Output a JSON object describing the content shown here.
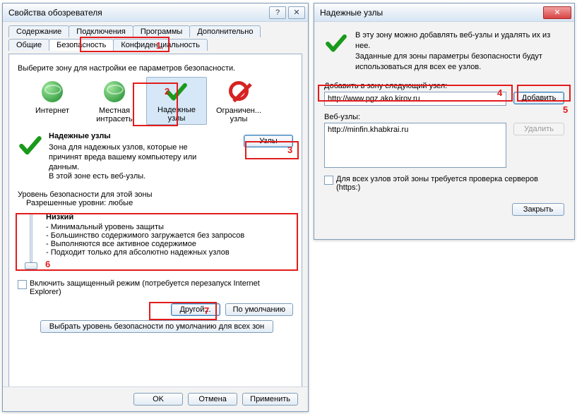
{
  "left": {
    "title": "Свойства обозревателя",
    "tabs_row1": [
      "Содержание",
      "Подключения",
      "Программы",
      "Дополнительно"
    ],
    "tabs_row2": [
      "Общие",
      "Безопасность",
      "Конфиденциальность"
    ],
    "active_tab": "Безопасность",
    "instruction": "Выберите зону для настройки ее параметров безопасности.",
    "zones": [
      {
        "label": "Интернет"
      },
      {
        "label2": "Местная",
        "label3": "интрасеть"
      },
      {
        "label2": "Надежные",
        "label3": "узлы"
      },
      {
        "label2": "Ограничен...",
        "label3": "узлы"
      }
    ],
    "zone_header_title": "Надежные узлы",
    "zone_header_desc_1": "Зона для надежных узлов, которые не",
    "zone_header_desc_2": "причинят вреда вашему компьютеру или",
    "zone_header_desc_3": "данным.",
    "zone_header_desc_4": "В этой зоне есть веб-узлы.",
    "nodes_btn": "Узлы",
    "sec_level_label": "Уровень безопасности для этой зоны",
    "allowed_levels": "Разрешенные уровни: любые",
    "level_name": "Низкий",
    "level_bullets": [
      "Минимальный уровень защиты",
      "Большинство содержимого загружается без запросов",
      "Выполняются все активное содержимое",
      "Подходит только для абсолютно надежных узлов"
    ],
    "protected_mode": "Включить защищенный режим (потребуется перезапуск Internet Explorer)",
    "btn_other": "Другой...",
    "btn_default": "По умолчанию",
    "btn_reset_all": "Выбрать уровень безопасности по умолчанию для всех зон",
    "btn_ok": "OK",
    "btn_cancel": "Отмена",
    "btn_apply": "Применить"
  },
  "right": {
    "title": "Надежные узлы",
    "desc_1": "В эту зону можно добавлять веб-узлы и удалять их из нее.",
    "desc_2": "Заданные для зоны параметры безопасности будут",
    "desc_3": "использоваться для всех ее узлов.",
    "add_label": "Добавить в зону следующий узел:",
    "add_value": "http://www.pgz.ako.kirov.ru",
    "btn_add": "Добавить",
    "sites_label": "Веб-узлы:",
    "sites": [
      "http://minfin.khabkrai.ru"
    ],
    "btn_remove": "Удалить",
    "https_check": "Для всех узлов этой зоны требуется проверка серверов (https:)",
    "btn_close": "Закрыть"
  },
  "annotations": [
    "1",
    "2",
    "3",
    "4",
    "5",
    "6",
    "7"
  ]
}
